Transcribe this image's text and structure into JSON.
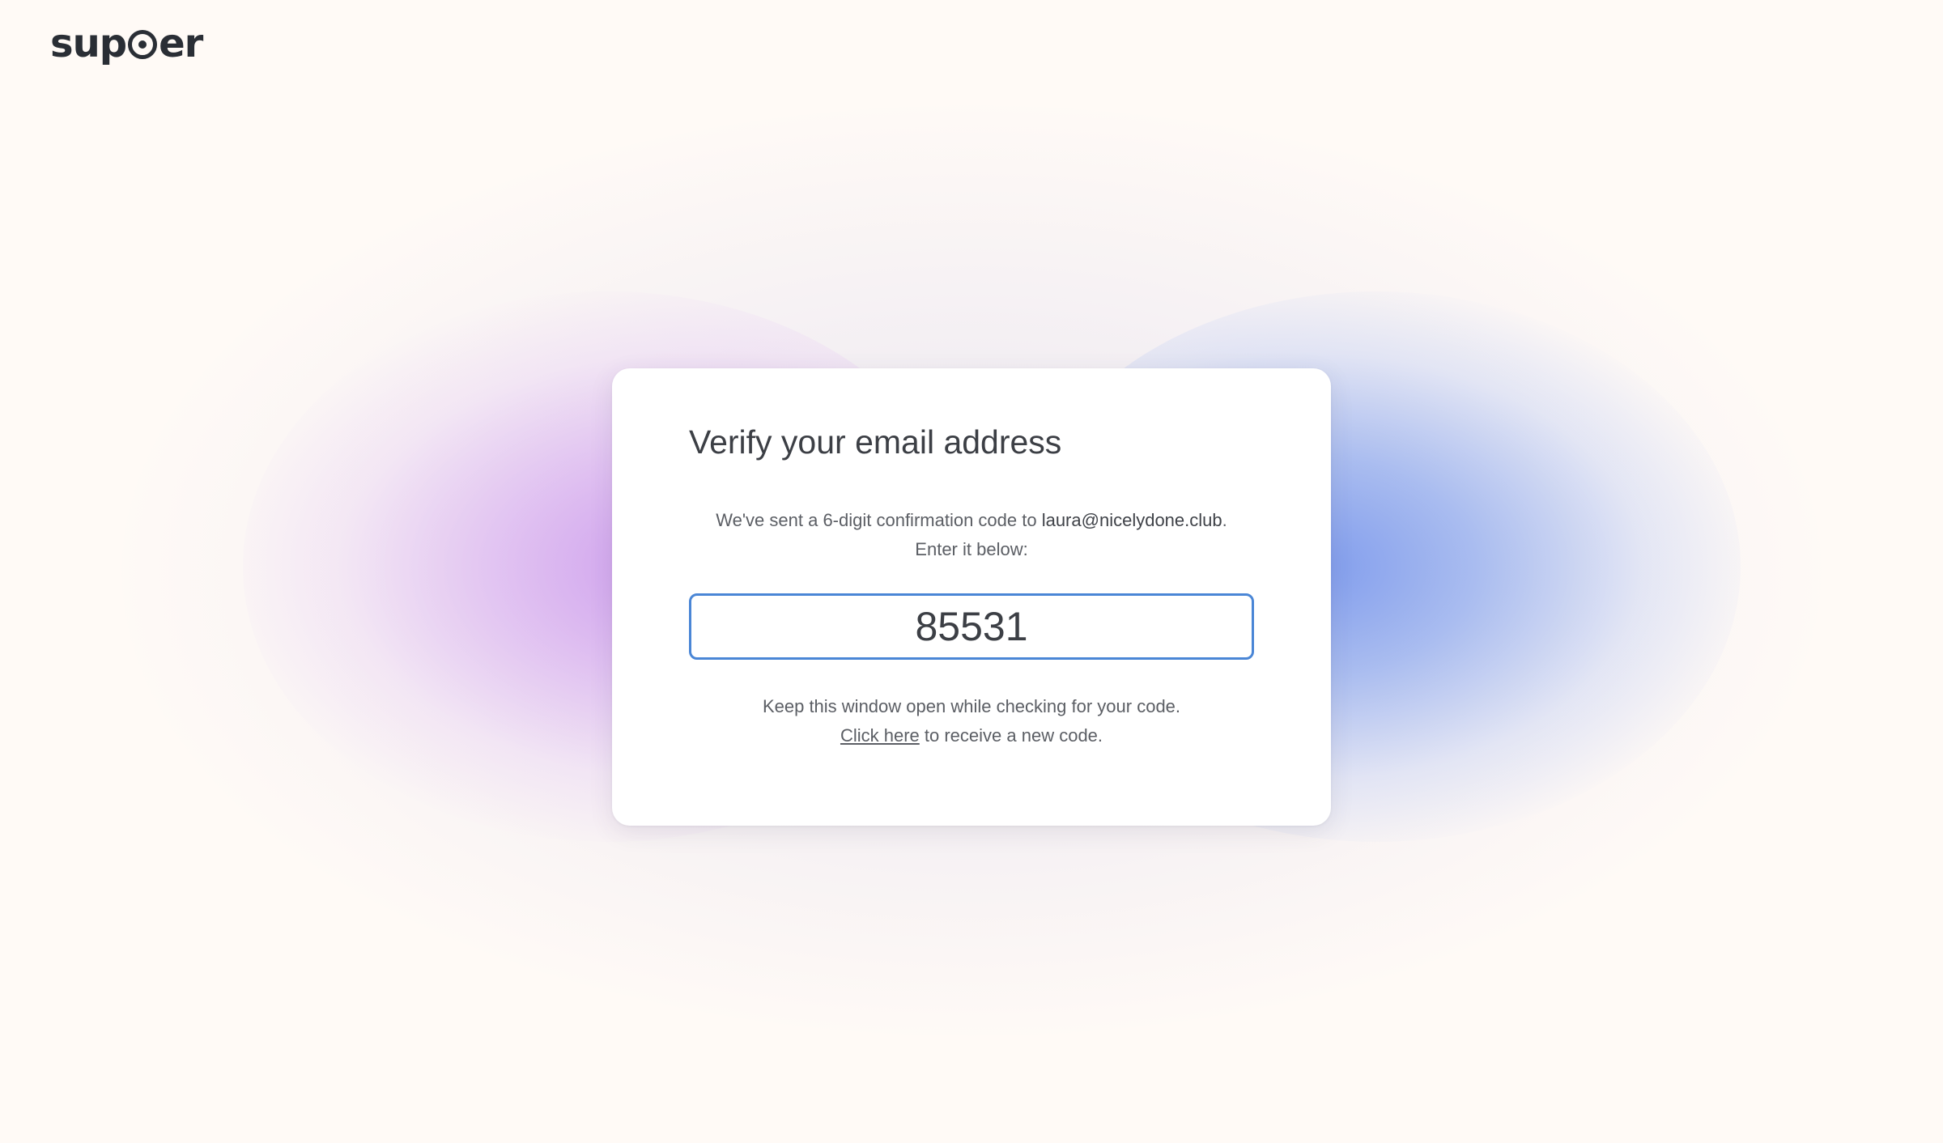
{
  "brand": {
    "logo_prefix": "sup",
    "logo_suffix": "er"
  },
  "card": {
    "title": "Verify your email address",
    "desc_prefix": "We've sent a 6-digit confirmation code to ",
    "email": "laura@nicelydone.club",
    "desc_suffix": ".",
    "desc_line2": "Enter it below:",
    "code_value": "85531",
    "keep_open_text": "Keep this window open while checking for your code.",
    "resend_link": "Click here",
    "resend_suffix": " to receive a new code."
  },
  "colors": {
    "background": "#fffaf6",
    "input_border": "#4a86d6",
    "glow_purple": "#c996ec",
    "glow_blue": "#7896ec",
    "text": "#3c3f45"
  }
}
